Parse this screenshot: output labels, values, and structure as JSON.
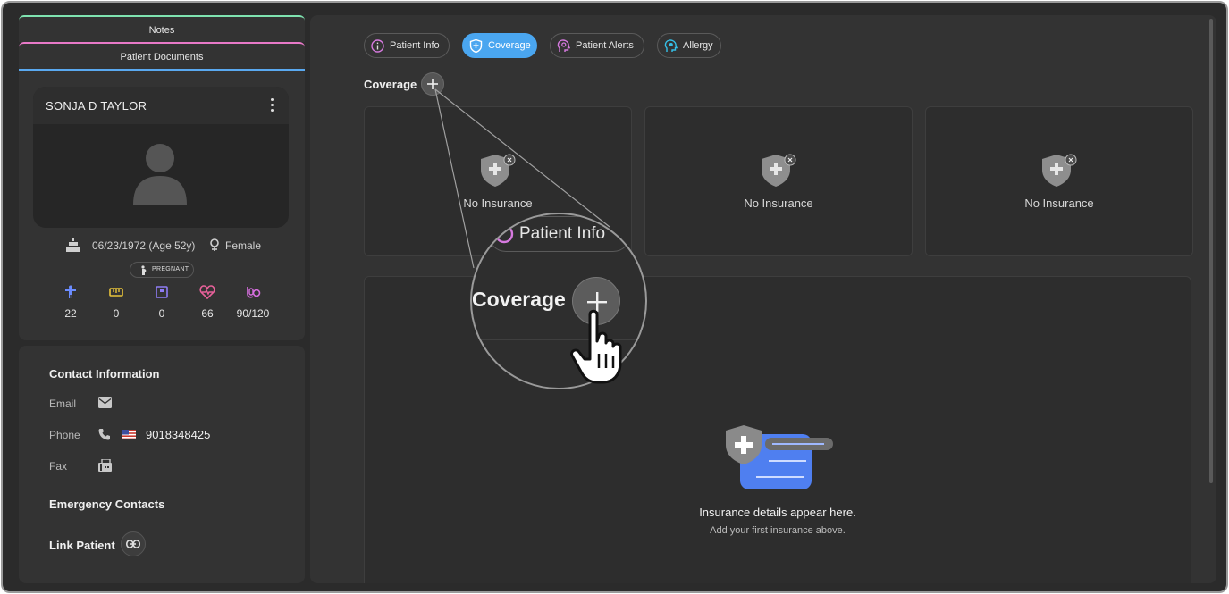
{
  "sidebar": {
    "tabs": {
      "notes": "Notes",
      "documents": "Patient Documents"
    },
    "patient": {
      "name": "SONJA D TAYLOR",
      "dob": "06/23/1972 (Age 52y)",
      "gender": "Female",
      "badge": "PREGNANT",
      "vitals": [
        {
          "icon": "body-icon",
          "value": "22",
          "color": "#6b8cff"
        },
        {
          "icon": "ruler-icon",
          "value": "0",
          "color": "#e8c33a"
        },
        {
          "icon": "scale-icon",
          "value": "0",
          "color": "#8f7cf5"
        },
        {
          "icon": "heart-pulse-icon",
          "value": "66",
          "color": "#e8619a"
        },
        {
          "icon": "blood-pressure-icon",
          "value": "90/120",
          "color": "#d86fe0"
        }
      ]
    },
    "contact": {
      "heading": "Contact Information",
      "email_label": "Email",
      "phone_label": "Phone",
      "phone_value": "9018348425",
      "fax_label": "Fax",
      "emergency_heading": "Emergency Contacts",
      "link_patient": "Link Patient"
    }
  },
  "main": {
    "tabs": [
      {
        "label": "Patient Info",
        "icon": "info-icon",
        "active": false
      },
      {
        "label": "Coverage",
        "icon": "shield-plus-icon",
        "active": true
      },
      {
        "label": "Patient Alerts",
        "icon": "alert-head-icon",
        "active": false
      },
      {
        "label": "Allergy",
        "icon": "allergy-head-icon",
        "active": false
      }
    ],
    "coverage_title": "Coverage",
    "insurance_cards": [
      "No Insurance",
      "No Insurance",
      "No Insurance"
    ],
    "empty_title": "Insurance details appear here.",
    "empty_subtitle": "Add your first insurance above."
  },
  "zoom_callout": {
    "tab_label": "Patient Info",
    "coverage_label": "Coverage"
  },
  "colors": {
    "accent": "#4aa6f0",
    "background": "#2b2b2b",
    "panel": "#333333"
  }
}
